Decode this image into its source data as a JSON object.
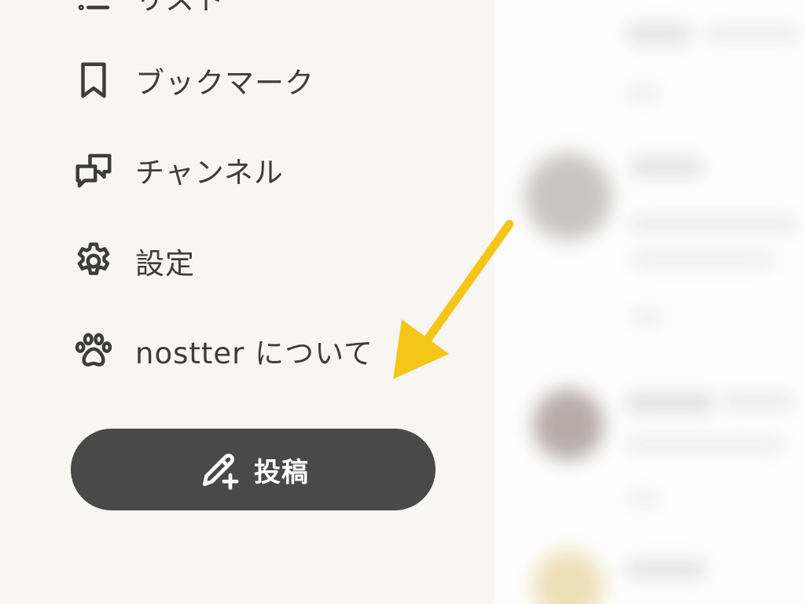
{
  "sidebar": {
    "items": [
      {
        "label": "リスト",
        "icon": "list-icon"
      },
      {
        "label": "ブックマーク",
        "icon": "bookmark-icon"
      },
      {
        "label": "チャンネル",
        "icon": "channel-icon"
      },
      {
        "label": "設定",
        "icon": "gear-icon"
      },
      {
        "label": "nostter について",
        "icon": "paw-icon"
      }
    ],
    "post_button": {
      "label": "投稿",
      "icon": "pencil-plus-icon"
    }
  },
  "colors": {
    "sidebar_bg": "#f8f6f2",
    "button_bg": "#494949",
    "arrow": "#f5c518"
  }
}
